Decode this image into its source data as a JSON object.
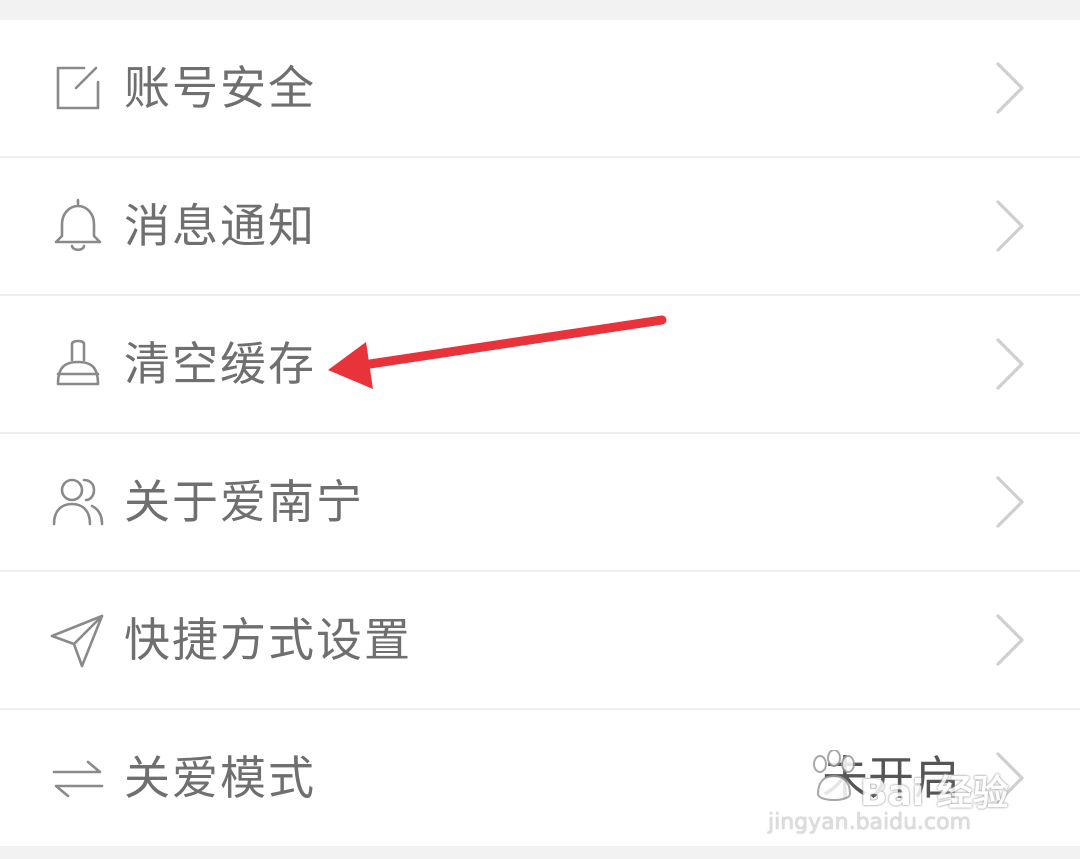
{
  "settings": {
    "items": [
      {
        "label": "账号安全",
        "icon": "edit-icon"
      },
      {
        "label": "消息通知",
        "icon": "bell-icon"
      },
      {
        "label": "清空缓存",
        "icon": "broom-icon"
      },
      {
        "label": "关于爱南宁",
        "icon": "users-icon"
      },
      {
        "label": "快捷方式设置",
        "icon": "paper-plane-icon"
      },
      {
        "label": "关爱模式",
        "icon": "swap-arrows-icon",
        "value": "未开启"
      }
    ]
  },
  "annotation": {
    "color": "#e8333a",
    "points_to": "清空缓存"
  },
  "watermark": {
    "brand": "Bai 经验",
    "url": "jingyan.baidu.com"
  },
  "colors": {
    "background": "#f2f2f2",
    "row": "#ffffff",
    "text": "#6f6f6f",
    "divider": "#eeeeee",
    "chevron": "#cfcfcf"
  }
}
